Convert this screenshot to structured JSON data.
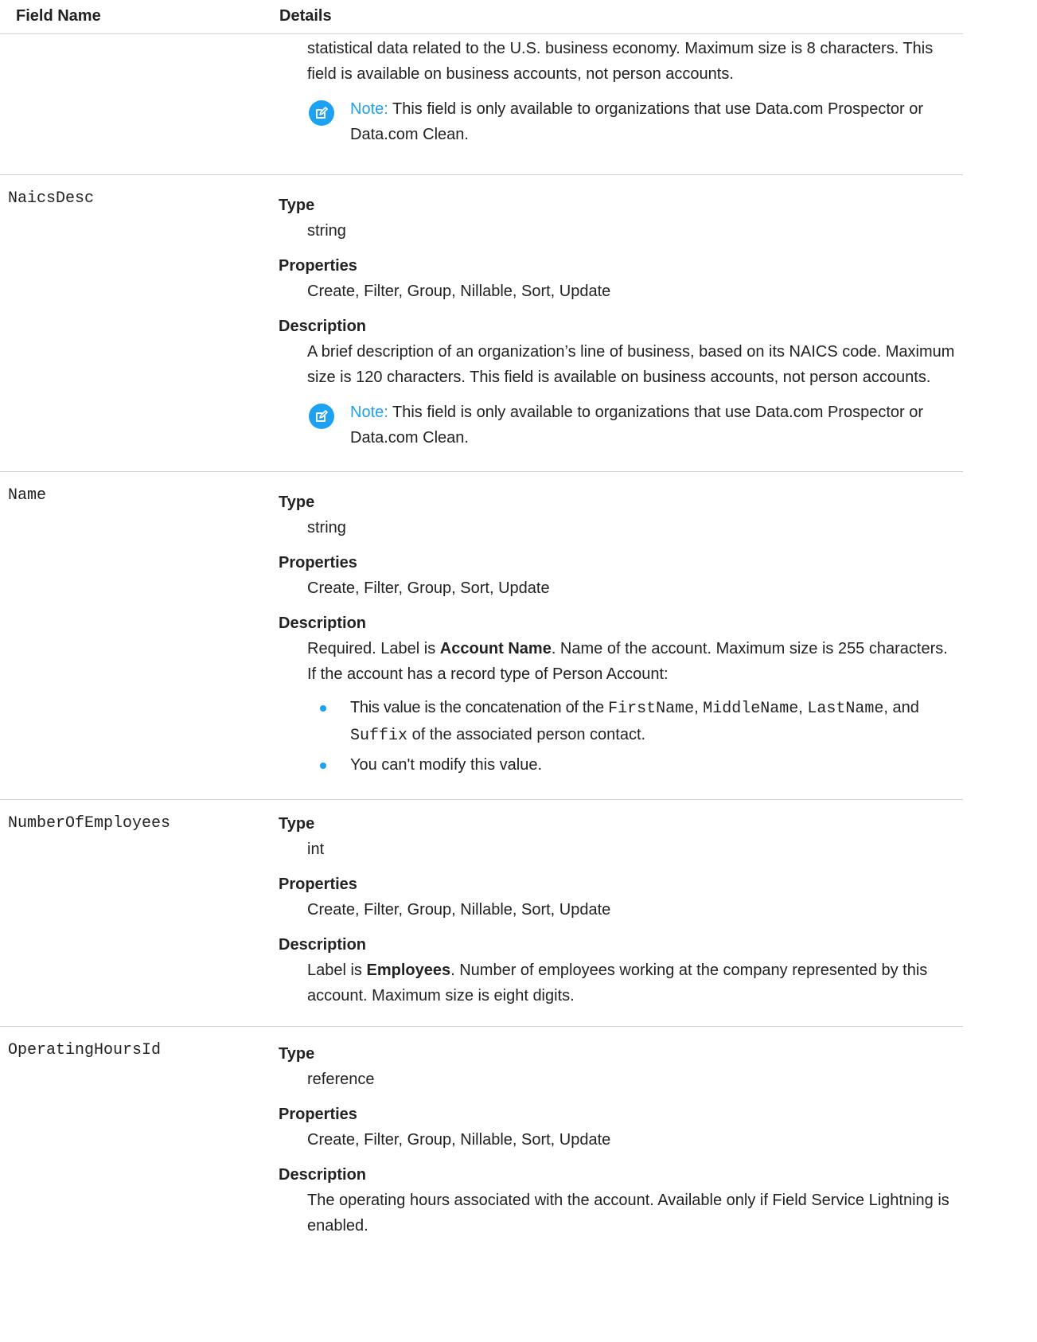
{
  "header": {
    "field_name": "Field Name",
    "details": "Details"
  },
  "top_fragment": {
    "text": "statistical data related to the U.S. business economy. Maximum size is 8 characters. This field is available on business accounts, not person accounts.",
    "note_label": "Note:",
    "note_text": "This field is only available to organizations that use Data.com Prospector or Data.com Clean."
  },
  "labels": {
    "type": "Type",
    "properties": "Properties",
    "description": "Description"
  },
  "fields": {
    "naicsdesc": {
      "name": "NaicsDesc",
      "type": "string",
      "properties": "Create, Filter, Group, Nillable, Sort, Update",
      "description": "A brief description of an organization’s line of business, based on its NAICS code. Maximum size is 120 characters. This field is available on business accounts, not person accounts.",
      "note_label": "Note:",
      "note_text": "This field is only available to organizations that use Data.com Prospector or Data.com Clean."
    },
    "name": {
      "name": "Name",
      "type": "string",
      "properties": "Create, Filter, Group, Sort, Update",
      "desc_pre": "Required. Label is ",
      "desc_bold": "Account Name",
      "desc_post": ". Name of the account. Maximum size is 255 characters. If the account has a record type of Person Account:",
      "bullet1_pre": "This value is the concatenation of the ",
      "bullet1_code1": "FirstName",
      "bullet1_sep1": ", ",
      "bullet1_code2": "MiddleName",
      "bullet1_sep2": ", ",
      "bullet1_code3": "LastName",
      "bullet1_sep3": ", and ",
      "bullet1_code4": "Suffix",
      "bullet1_post": " of the associated person contact.",
      "bullet2": "You can't modify this value."
    },
    "numberofemployees": {
      "name": "NumberOfEmployees",
      "type": "int",
      "properties": "Create, Filter, Group, Nillable, Sort, Update",
      "desc_pre": "Label is ",
      "desc_bold": "Employees",
      "desc_post": ". Number of employees working at the company represented by this account. Maximum size is eight digits."
    },
    "operatinghoursid": {
      "name": "OperatingHoursId",
      "type": "reference",
      "properties": "Create, Filter, Group, Nillable, Sort, Update",
      "description": "The operating hours associated with the account. Available only if Field Service Lightning is enabled."
    }
  }
}
